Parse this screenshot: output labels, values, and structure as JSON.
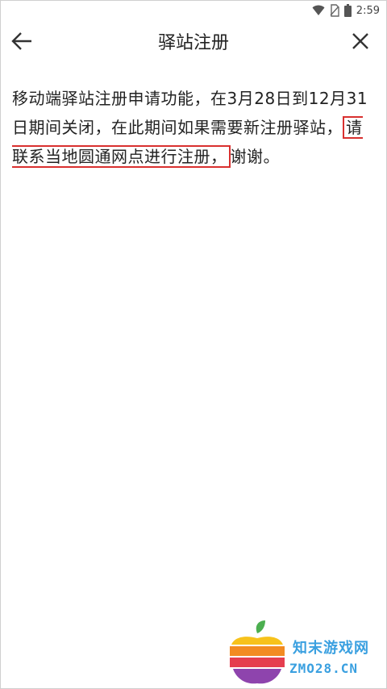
{
  "status": {
    "time": "2:59"
  },
  "header": {
    "title": "驿站注册"
  },
  "notice": {
    "part1": "移动端驿站注册申请功能，在3月28日到12月31日期间关闭，在此期间如果需要新注册驿站，",
    "highlight": "请联系当地圆通网点进行注册，",
    "part2": "谢谢。"
  },
  "watermark": {
    "name": "知末游戏网",
    "domain": "ZMO28.CN"
  }
}
